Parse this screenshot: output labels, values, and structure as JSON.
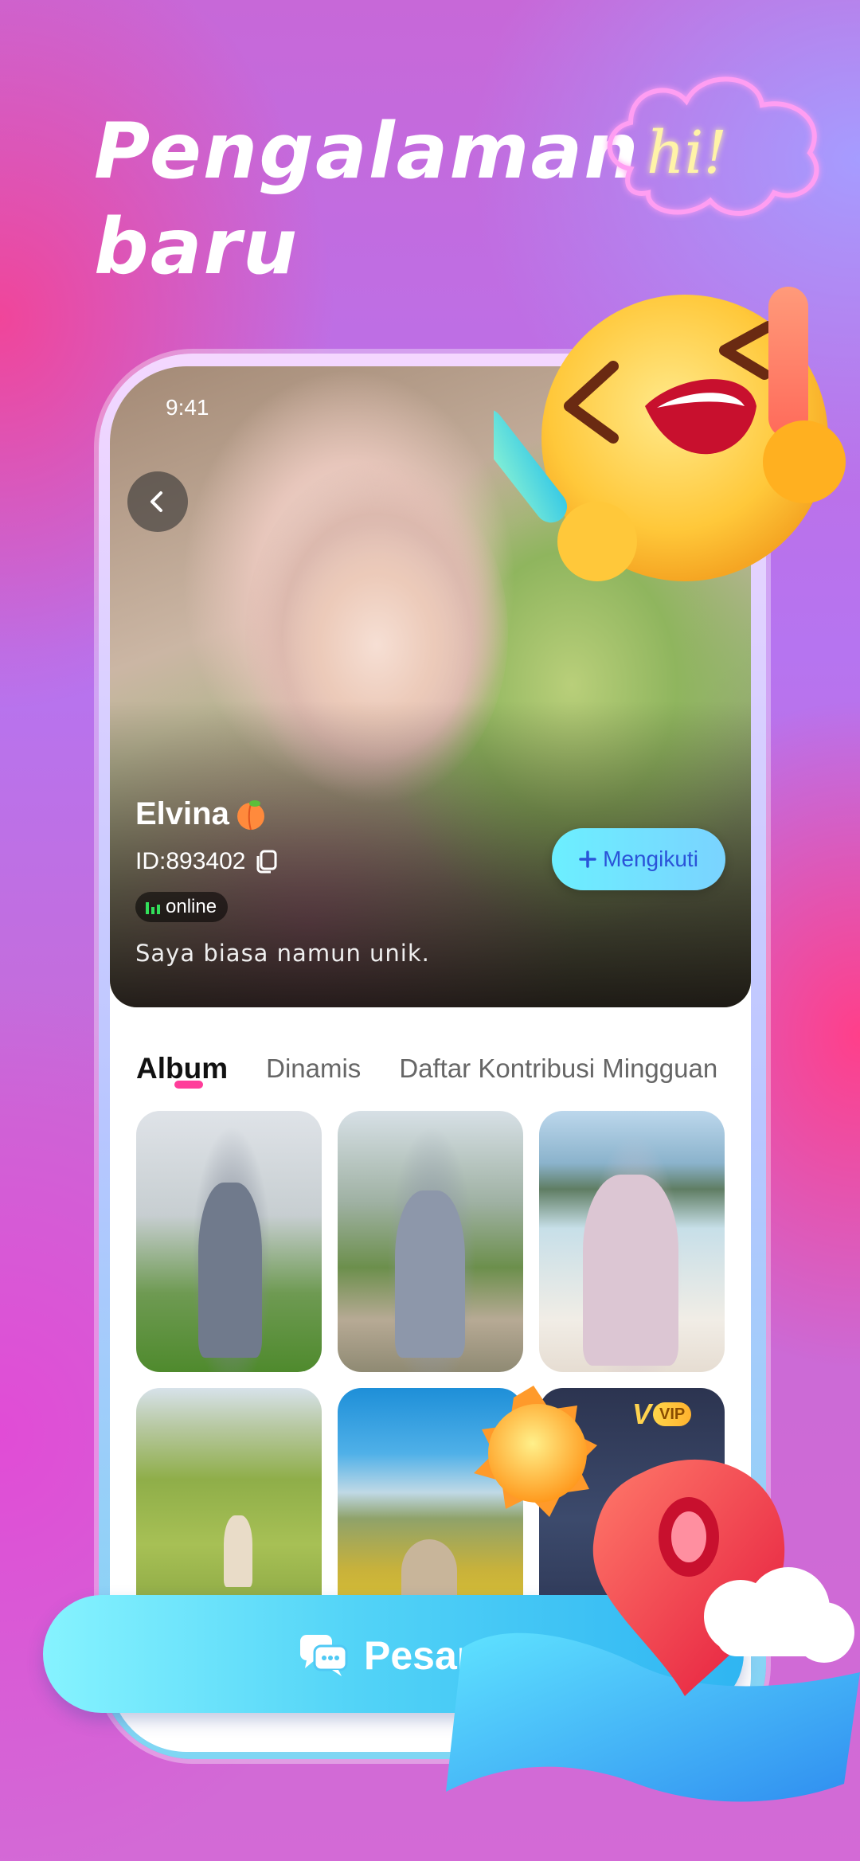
{
  "headline": {
    "line1": "Pengalaman",
    "line2": "baru"
  },
  "decor": {
    "neon_text": "hi!"
  },
  "status_bar": {
    "time": "9:41"
  },
  "profile": {
    "name": "Elvina",
    "id_text": "ID:893402",
    "status": "online",
    "bio": "Saya biasa namun unik.",
    "follow_label": "Mengikuti"
  },
  "tabs": [
    {
      "label": "Album",
      "active": true
    },
    {
      "label": "Dinamis",
      "active": false
    },
    {
      "label": "Daftar Kontribusi Mingguan",
      "active": false
    }
  ],
  "album": {
    "photos": [
      "photo-1",
      "photo-2",
      "photo-3",
      "photo-4",
      "photo-5",
      "photo-6"
    ],
    "vip_badge": "VIP",
    "vip_letter": "V"
  },
  "chat_button": {
    "label": "Pesan"
  },
  "colors": {
    "accent_pink": "#ff3d9a",
    "follow_text": "#2a53d8",
    "online_green": "#32e05a",
    "chat_gradient_start": "#86f3ff",
    "chat_gradient_end": "#2fb5f2"
  },
  "icons": [
    "back-arrow-icon",
    "peach-icon",
    "copy-icon",
    "signal-bars-icon",
    "plus-icon",
    "chat-bubbles-icon"
  ]
}
